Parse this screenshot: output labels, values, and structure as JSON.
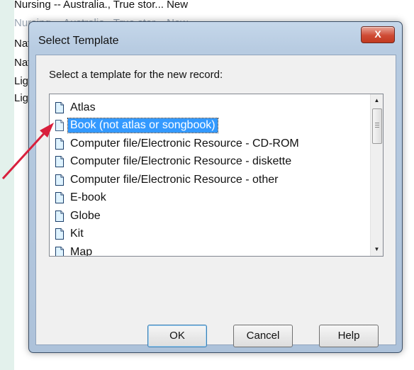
{
  "background": {
    "rows": [
      "Nursing -- Australia., True stor... New",
      "Nursing -- Australia., True stor... New",
      "Nat",
      "Nat",
      "Lig",
      "Lig"
    ]
  },
  "dialog": {
    "title": "Select Template",
    "close_glyph": "X",
    "prompt": "Select a template for the new record:",
    "items": [
      "Atlas",
      "Book (not atlas or songbook)",
      "Computer file/Electronic Resource - CD-ROM",
      "Computer file/Electronic Resource - diskette",
      "Computer file/Electronic Resource - other",
      "E-book",
      "Globe",
      "Kit",
      "Map"
    ],
    "selected_index": 1,
    "buttons": {
      "ok": "OK",
      "cancel": "Cancel",
      "help": "Help"
    },
    "scroll_up_glyph": "▲",
    "scroll_down_glyph": "▼"
  },
  "colors": {
    "selection": "#3399ff",
    "annotation_arrow": "#d81f3c",
    "close_button": "#cf4b35"
  },
  "icons": {
    "list_item": "document-icon",
    "annotation": "red-arrow"
  }
}
